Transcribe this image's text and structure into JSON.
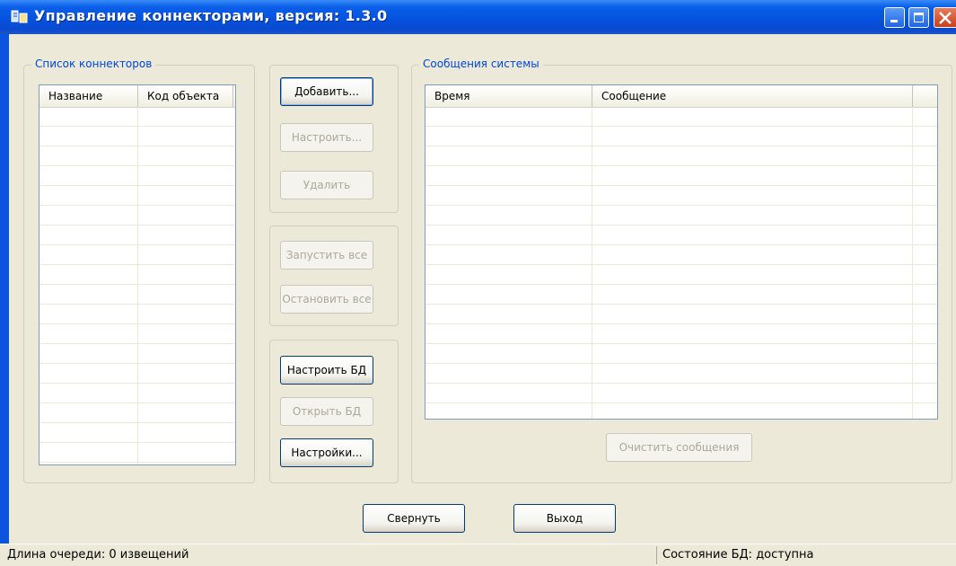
{
  "window": {
    "title": "Управление коннекторами, версия: 1.3.0"
  },
  "connectors": {
    "group_title": "Список коннекторов",
    "columns": [
      "Название",
      "Код объекта"
    ]
  },
  "actions": {
    "add": "Добавить...",
    "configure": "Настроить...",
    "delete": "Удалить",
    "start_all": "Запустить все",
    "stop_all": "Остановить все",
    "configure_db": "Настроить БД",
    "open_db": "Открыть БД",
    "settings": "Настройки..."
  },
  "messages": {
    "group_title": "Сообщения системы",
    "columns": [
      "Время",
      "Сообщение"
    ],
    "clear": "Очистить сообщения"
  },
  "footer": {
    "minimize": "Свернуть",
    "exit": "Выход"
  },
  "status": {
    "queue": "Длина очереди: 0 извещений",
    "db_state": "Состояние БД: доступна"
  },
  "colors": {
    "title_bar": "#0a54e0",
    "client_bg": "#ece9d8",
    "group_title": "#0046d5"
  }
}
